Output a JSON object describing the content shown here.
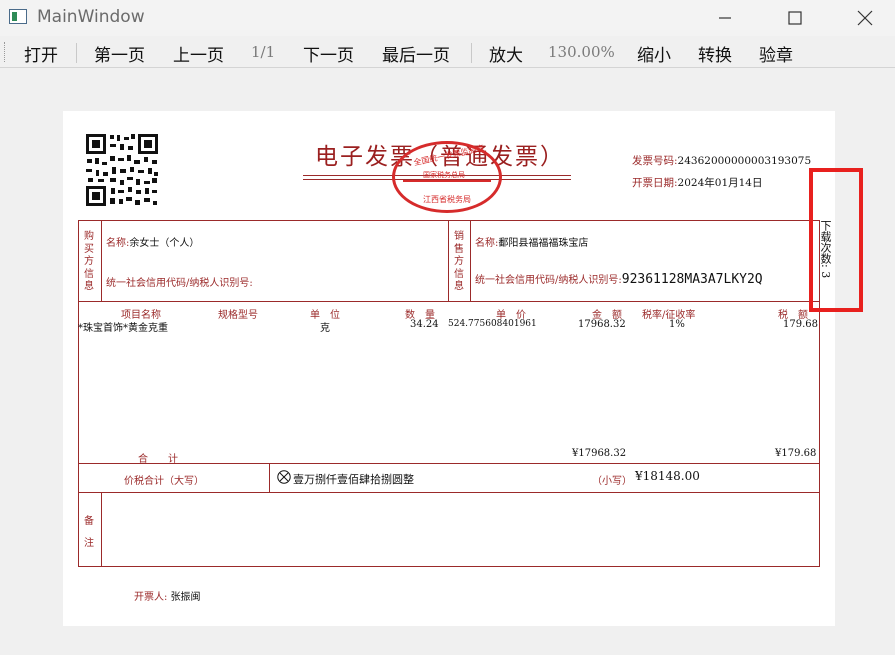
{
  "window": {
    "title": "MainWindow",
    "minimize_icon": "minimize-icon",
    "maximize_icon": "maximize-icon",
    "close_icon": "close-icon"
  },
  "toolbar": {
    "open": "打开",
    "first_page": "第一页",
    "prev_page": "上一页",
    "page_indicator": "1/1",
    "next_page": "下一页",
    "last_page": "最后一页",
    "zoom_in": "放大",
    "zoom_level": "130.00%",
    "zoom_out": "缩小",
    "convert": "转换",
    "verify_seal": "验章"
  },
  "invoice": {
    "title": "电子发票（普通发票）",
    "invoice_no_label": "发票号码:",
    "invoice_no": "24362000000003193075",
    "issue_date_label": "开票日期:",
    "issue_date": "2024年01月14日",
    "stamp": {
      "line1": "全国统一发票监制章",
      "line2": "国家税务总局",
      "line3": "江西省税务局"
    },
    "buyer": {
      "section_label": "购买方信息",
      "name_label": "名称:",
      "name": "余女士（个人）",
      "tax_id_label": "统一社会信用代码/纳税人识别号:",
      "tax_id": ""
    },
    "seller": {
      "section_label": "销售方信息",
      "name_label": "名称:",
      "name": "鄱阳县福福福珠宝店",
      "tax_id_label": "统一社会信用代码/纳税人识别号:",
      "tax_id": "92361128MA3A7LKY2Q"
    },
    "columns": {
      "item_name": "项目名称",
      "spec": "规格型号",
      "unit": "单　位",
      "quantity": "数　量",
      "unit_price": "单　价",
      "amount": "金　额",
      "tax_rate": "税率/征收率",
      "tax": "税　额"
    },
    "items": [
      {
        "name": "*珠宝首饰*黄金克重",
        "spec": "",
        "unit": "克",
        "quantity": "34.24",
        "unit_price": "524.775608401961",
        "amount": "17968.32",
        "tax_rate": "1%",
        "tax": "179.68"
      }
    ],
    "subtotal_label": "合　　计",
    "subtotal_amount": "¥17968.32",
    "subtotal_tax": "¥179.68",
    "total_label": "价税合计（大写）",
    "total_words": "壹万捌仟壹佰肆拾捌圆整",
    "total_small_label": "（小写）",
    "total_small": "¥18148.00",
    "remarks_label": "备注",
    "issuer_label": "开票人:",
    "issuer": "张振闽",
    "download_count_label": "下载次数:",
    "download_count": "3"
  },
  "colors": {
    "invoice_red": "#9b2a2a",
    "stamp_red": "#d62b2b",
    "highlight_red": "#e8201e"
  }
}
